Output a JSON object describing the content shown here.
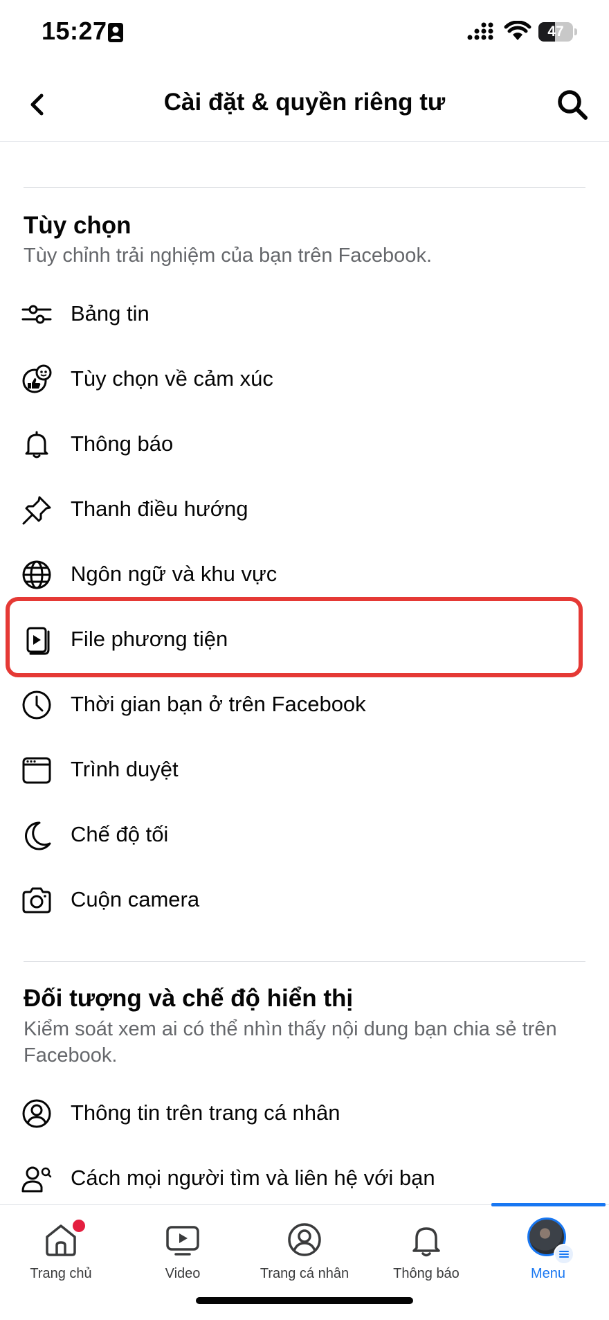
{
  "status_bar": {
    "time": "15:27",
    "battery": "47"
  },
  "header": {
    "title": "Cài đặt & quyền riêng tư"
  },
  "preferences": {
    "title": "Tùy chọn",
    "subtitle": "Tùy chỉnh trải nghiệm của bạn trên Facebook.",
    "items": [
      {
        "label": "Bảng tin",
        "icon": "sliders-icon"
      },
      {
        "label": "Tùy chọn về cảm xúc",
        "icon": "reaction-icon"
      },
      {
        "label": "Thông báo",
        "icon": "bell-icon"
      },
      {
        "label": "Thanh điều hướng",
        "icon": "pin-icon"
      },
      {
        "label": "Ngôn ngữ và khu vực",
        "icon": "globe-icon"
      },
      {
        "label": "File phương tiện",
        "icon": "media-icon"
      },
      {
        "label": "Thời gian bạn ở trên Facebook",
        "icon": "clock-icon"
      },
      {
        "label": "Trình duyệt",
        "icon": "browser-icon"
      },
      {
        "label": "Chế độ tối",
        "icon": "moon-icon"
      },
      {
        "label": "Cuộn camera",
        "icon": "camera-icon"
      }
    ]
  },
  "audience": {
    "title": "Đối tượng và chế độ hiển thị",
    "subtitle": "Kiểm soát xem ai có thể nhìn thấy nội dung bạn chia sẻ trên Facebook.",
    "items": [
      {
        "label": "Thông tin trên trang cá nhân",
        "icon": "profile-icon"
      },
      {
        "label": "Cách mọi người tìm và liên hệ với bạn",
        "icon": "people-search-icon"
      }
    ]
  },
  "bottom_nav": {
    "tabs": [
      {
        "label": "Trang chủ",
        "icon": "home-icon"
      },
      {
        "label": "Video",
        "icon": "video-icon"
      },
      {
        "label": "Trang cá nhân",
        "icon": "profile-icon"
      },
      {
        "label": "Thông báo",
        "icon": "bell-icon"
      },
      {
        "label": "Menu",
        "icon": "avatar"
      }
    ],
    "active_tab": "Menu"
  },
  "colors": {
    "accent": "#1877f2",
    "highlight": "#e53935",
    "notification_dot": "#e41e3f",
    "secondary_text": "#65676b"
  }
}
